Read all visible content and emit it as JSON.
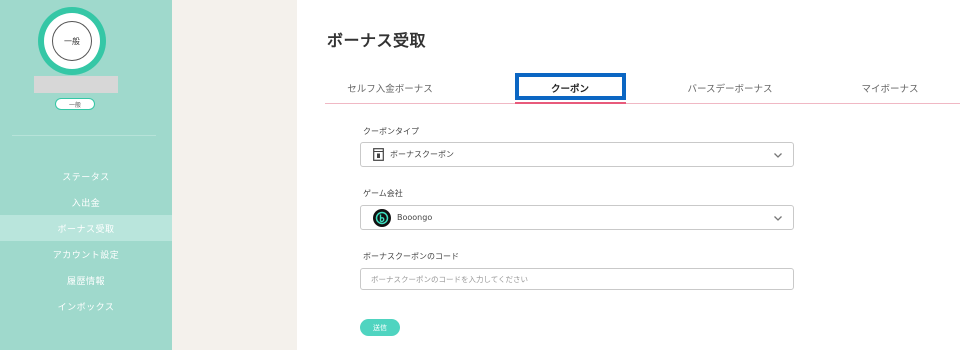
{
  "user": {
    "avatar_label": "一般",
    "rank_label": "一般"
  },
  "sidebar": {
    "items": [
      {
        "label": "ステータス",
        "active": false
      },
      {
        "label": "入出金",
        "active": false
      },
      {
        "label": "ボーナス受取",
        "active": true
      },
      {
        "label": "アカウント設定",
        "active": false
      },
      {
        "label": "履歴情報",
        "active": false
      },
      {
        "label": "インボックス",
        "active": false
      }
    ]
  },
  "main": {
    "title": "ボーナス受取",
    "tabs": [
      {
        "label": "セルフ入金ボーナス"
      },
      {
        "label": "クーポン"
      },
      {
        "label": "バースデーボーナス"
      },
      {
        "label": "マイボーナス"
      }
    ],
    "active_tab": 1
  },
  "form": {
    "coupon_type": {
      "label": "クーポンタイプ",
      "value": "ボーナスクーポン",
      "icon": "coupon-icon"
    },
    "provider": {
      "label": "ゲーム会社",
      "value": "Booongo",
      "icon": "booongo-logo-icon"
    },
    "code": {
      "label": "ボーナスクーポンのコード",
      "placeholder": "ボーナスクーポンのコードを入力してください",
      "value": ""
    },
    "submit_label": "送信"
  },
  "colors": {
    "sidebar_bg": "#9fd9cc",
    "accent": "#35c7a6",
    "tab_underline": "#e85a7b",
    "active_tab_outline": "#0b66c3",
    "submit_bg": "#4fd4c0"
  }
}
